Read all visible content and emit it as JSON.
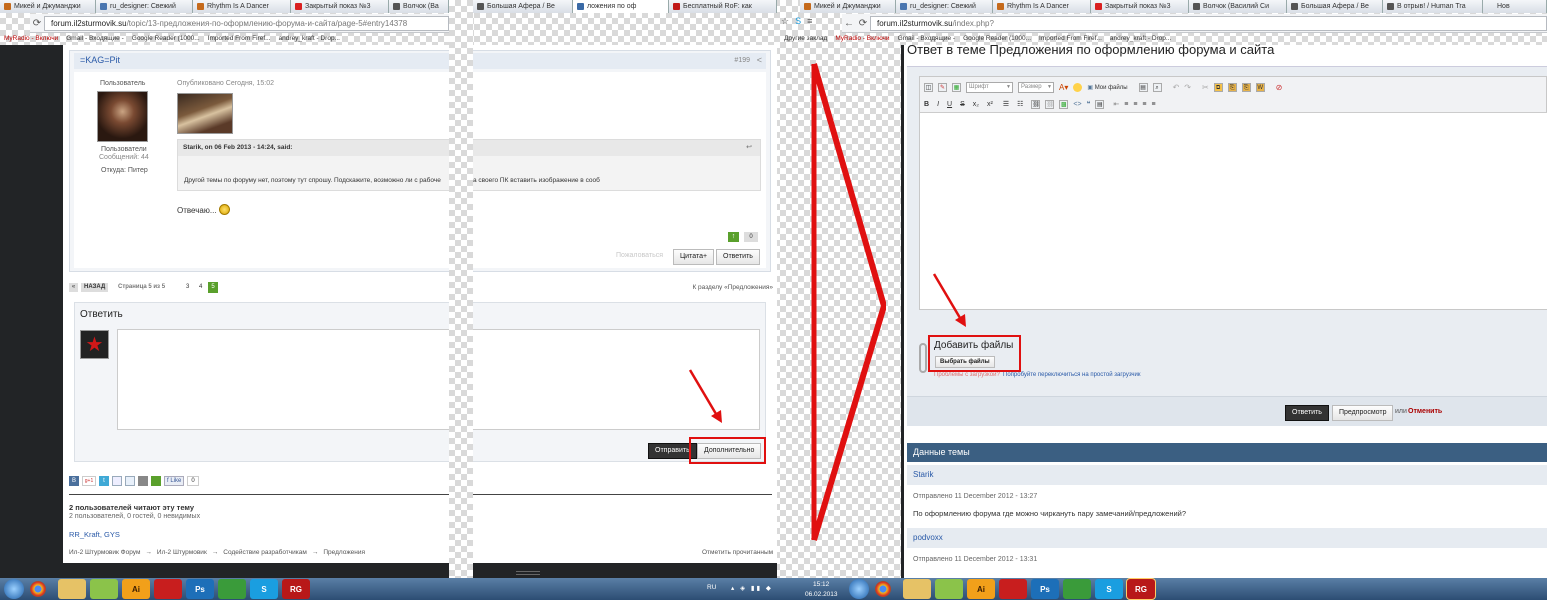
{
  "left_browser": {
    "tabs": [
      {
        "label": "Микей и Джуманджи",
        "color": "#c56a1c"
      },
      {
        "label": "ru_designer: Свежий",
        "color": "#4a76b0"
      },
      {
        "label": "Rhythm Is A Dancer",
        "color": "#c56a1c"
      },
      {
        "label": "Закрытый показ №3",
        "color": "#d92020"
      },
      {
        "label": "Волчок (Ва",
        "color": "#555"
      }
    ],
    "tabs_extra": [
      {
        "label": "Большая Афера / Be",
        "color": "#555"
      },
      {
        "label": "ложения по оф",
        "color": "#3a6aa6"
      },
      {
        "label": "Бесплатный RoF: как",
        "color": "#c01818"
      }
    ],
    "url_host": "forum.il2sturmovik.su",
    "url_path": "/topic/13-предложения-по-оформлению-форума-и-сайта/page-5#entry14378",
    "bookmarks": [
      "MyRadio - Включи",
      "Gmail - Входящие -",
      "Google Reader (1000...",
      "Imported From Firef...",
      "andrey_kraft - Drop..."
    ]
  },
  "post": {
    "author": "=KAG=Pit",
    "post_number": "#199",
    "role": "Пользователь",
    "published": "Опубликовано Сегодня, 15:02",
    "group": "Пользователи",
    "message_count": "Сообщений: 44",
    "location": "Откуда: Питер",
    "quote_header": "Starik, on 06 Feb 2013 - 14:24, said:",
    "quote_text": "Другой темы по форуму нет, поэтому тут спрошу. Подскажите, возможно ли с рабоче",
    "quote_text_tail": "а своего ПК вставить изображение в сооб",
    "reply_text": "Отвечаю...",
    "reputation": "0",
    "report_label": "Пожаловаться",
    "quote_button": "Цитата+",
    "answer_button": "Ответить"
  },
  "pagination": {
    "back": "НАЗАД",
    "label": "Страница 5 из 5",
    "pages": [
      "3",
      "4"
    ],
    "current": "5",
    "forum_link": "К разделу «Предложения»"
  },
  "reply_box": {
    "title": "Ответить",
    "send_button": "Отправить",
    "more_button": "Дополнительно"
  },
  "share": {
    "like_label": "Like",
    "like_count": "0"
  },
  "readers": {
    "title": "2 пользователей читают эту тему",
    "subtitle": "2 пользователей, 0 гостей, 0 невидимых",
    "names": "RR_Kraft, GYS"
  },
  "breadcrumb": {
    "items": [
      "Ил-2 Штурмовик Форум",
      "Ил-2 Штурмовик",
      "Содействие разработчикам",
      "Предложения"
    ],
    "separator": "→",
    "mark_read": "Отметить прочитанным"
  },
  "tray": {
    "lang": "RU",
    "time": "15:12",
    "date": "06.02.2013"
  },
  "right_browser": {
    "tabs": [
      {
        "label": "Микей и Джуманджи",
        "color": "#c56a1c"
      },
      {
        "label": "ru_designer: Свежий",
        "color": "#4a76b0"
      },
      {
        "label": "Rhythm Is A Dancer",
        "color": "#c56a1c"
      },
      {
        "label": "Закрытый показ №3",
        "color": "#d92020"
      },
      {
        "label": "Волчок (Василий Си",
        "color": "#555"
      },
      {
        "label": "Большая Афера / Be",
        "color": "#555"
      },
      {
        "label": "В отрыв! / Human Tra",
        "color": "#555"
      },
      {
        "label": "Нов",
        "color": "#555"
      }
    ],
    "url_host": "forum.il2sturmovik.su",
    "url_path": "/index.php?",
    "other_bookmarks": "Другие заклад",
    "bookmarks": [
      "MyRadio - Включи",
      "Gmail - Входящие -",
      "Google Reader (1000...",
      "Imported From Firef...",
      "andrey_kraft - Drop..."
    ]
  },
  "editor": {
    "heading": "Ответ в теме Предложения по оформлению форума и сайта",
    "font_placeholder": "Шрифт",
    "size_placeholder": "Размер",
    "my_files": "Мои файлы",
    "attach_title": "Добавить файлы",
    "choose_files": "Выбрать файлы",
    "upload_problem": "Проблемы с загрузкой?",
    "upload_hint": "Попробуйте переключиться на простой загрузчик",
    "submit": "Ответить",
    "preview": "Предпросмотр",
    "or": "или",
    "cancel": "Отменить"
  },
  "topic_data": {
    "title": "Данные темы",
    "posts": [
      {
        "author": "Starik",
        "date": "Отправлено 11 December 2012 - 13:27",
        "text": "По оформлению форума где можно чиркануть пару замечаний/предложений?"
      },
      {
        "author": "podvoxx",
        "date": "Отправлено 11 December 2012 - 13:31",
        "text": ""
      }
    ]
  },
  "taskbar_apps": [
    "",
    "",
    "",
    "Ai",
    "",
    "Ps",
    "",
    "S",
    "RG"
  ]
}
